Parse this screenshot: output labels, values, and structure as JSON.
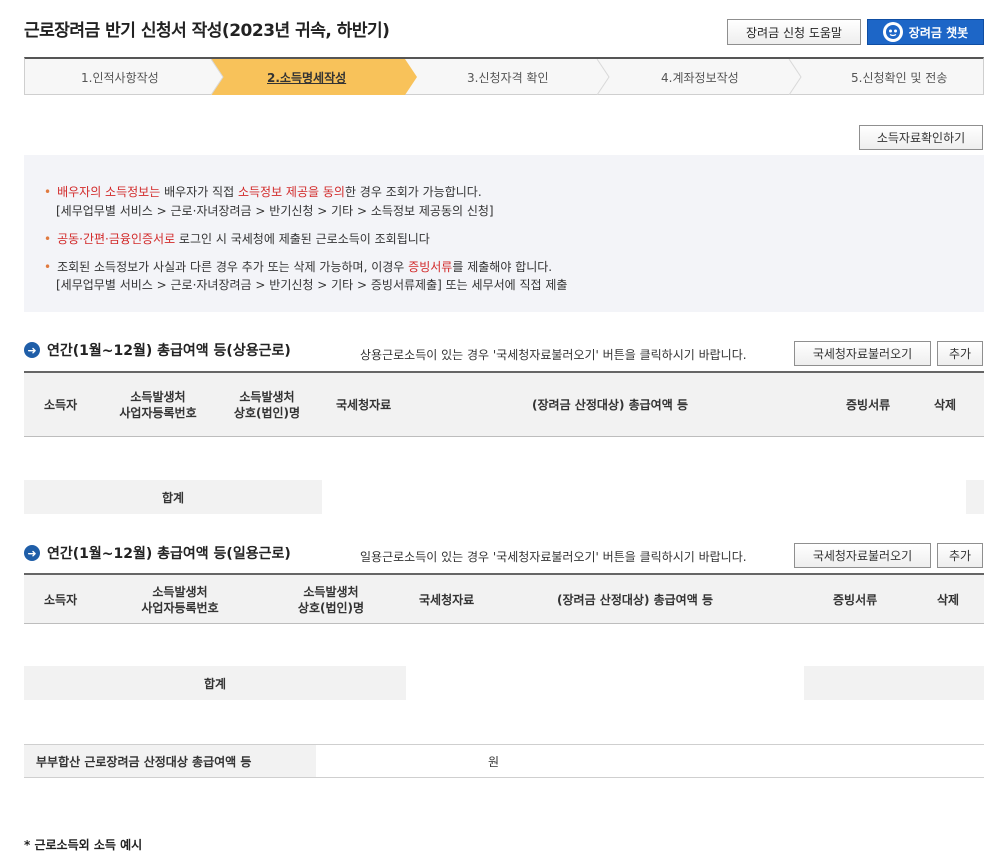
{
  "header": {
    "title": "근로장려금 반기 신청서 작성(2023년 귀속, 하반기)",
    "help_button": "장려금 신청 도움말",
    "bot_button": "장려금 챗봇"
  },
  "steps": [
    {
      "label": "1.인적사항작성",
      "active": false
    },
    {
      "label": "2.소득명세작성",
      "active": true
    },
    {
      "label": "3.신청자격 확인",
      "active": false
    },
    {
      "label": "4.계좌정보작성",
      "active": false
    },
    {
      "label": "5.신청확인 및 전송",
      "active": false
    }
  ],
  "income_check_button": "소득자료확인하기",
  "notice": {
    "l1a": "배우자의 소득정보는",
    "l1b": " 배우자가 직접 ",
    "l1c": "소득정보 제공을 동의",
    "l1d": "한 경우 조회가 가능합니다.",
    "l2": "[세무업무별 서비스 > 근로·자녀장려금 > 반기신청 > 기타 > 소득정보 제공동의 신청]",
    "l3a": "공동·간편·금융인증서로",
    "l3b": " 로그인 시 국세청에 제출된 근로소득이 조회됩니다",
    "l4a": "조회된 소득정보가 사실과 다른 경우 추가 또는 삭제 가능하며, 이경우 ",
    "l4b": "증빙서류",
    "l4c": "를 제출해야 합니다.",
    "l5": "[세무업무별 서비스 > 근로·자녀장려금 > 반기신청 > 기타 > 증빙서류제출] 또는 세무서에 직접 제출"
  },
  "section1": {
    "title": "연간(1월~12월) 총급여액 등(상용근로)",
    "note": "상용근로소득이 있는 경우 '국세청자료불러오기' 버튼을 클릭하시기 바랍니다.",
    "load_button": "국세청자료불러오기",
    "add_button": "추가",
    "columns": {
      "earner": "소득자",
      "bizno": "소득발생처\n사업자등록번호",
      "corp": "소득발생처\n상호(법인)명",
      "nts": "국세청자료",
      "total": "(장려금 산정대상) 총급여액 등",
      "evidence": "증빙서류",
      "delete": "삭제"
    },
    "sum_label": "합계"
  },
  "section2": {
    "title": "연간(1월~12월) 총급여액 등(일용근로)",
    "note": "일용근로소득이 있는 경우 '국세청자료불러오기' 버튼을 클릭하시기 바랍니다.",
    "load_button": "국세청자료불러오기",
    "add_button": "추가",
    "columns": {
      "earner": "소득자",
      "bizno": "소득발생처\n사업자등록번호",
      "corp": "소득발생처\n상호(법인)명",
      "nts": "국세청자료",
      "total": "(장려금 산정대상) 총급여액 등",
      "evidence": "증빙서류",
      "delete": "삭제"
    },
    "sum_label": "합계"
  },
  "couple_total": {
    "label": "부부합산 근로장려금 산정대상 총급여액 등",
    "unit": "원"
  },
  "footnote": "* 근로소득외 소득 예시"
}
